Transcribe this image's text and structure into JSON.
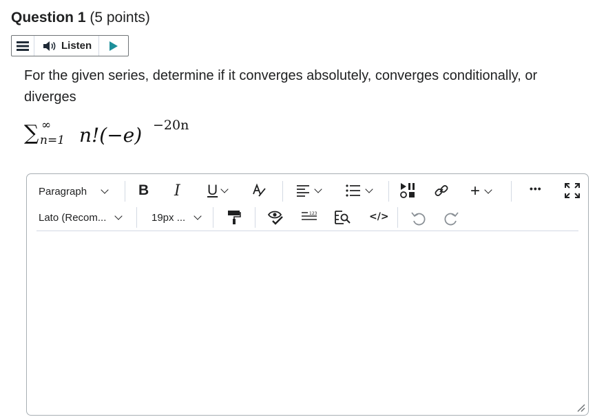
{
  "question": {
    "number_label": "Question 1",
    "points_label": "(5 points)"
  },
  "listen": {
    "label": "Listen"
  },
  "question_text": "For the given series, determine if it converges absolutely, converges conditionally, or diverges",
  "formula": {
    "sigma": "∑",
    "upper": "∞",
    "lower": "n=1",
    "body": "n!(−e)",
    "exponent": "−20n"
  },
  "toolbar": {
    "paragraph_label": "Paragraph",
    "bold_label": "B",
    "italic_label": "I",
    "underline_label": "U",
    "plus_label": "+",
    "more_label": "•••",
    "font_label": "Lato (Recom...",
    "size_label": "19px ...",
    "source_label": "</>",
    "numbering_label": "123"
  }
}
